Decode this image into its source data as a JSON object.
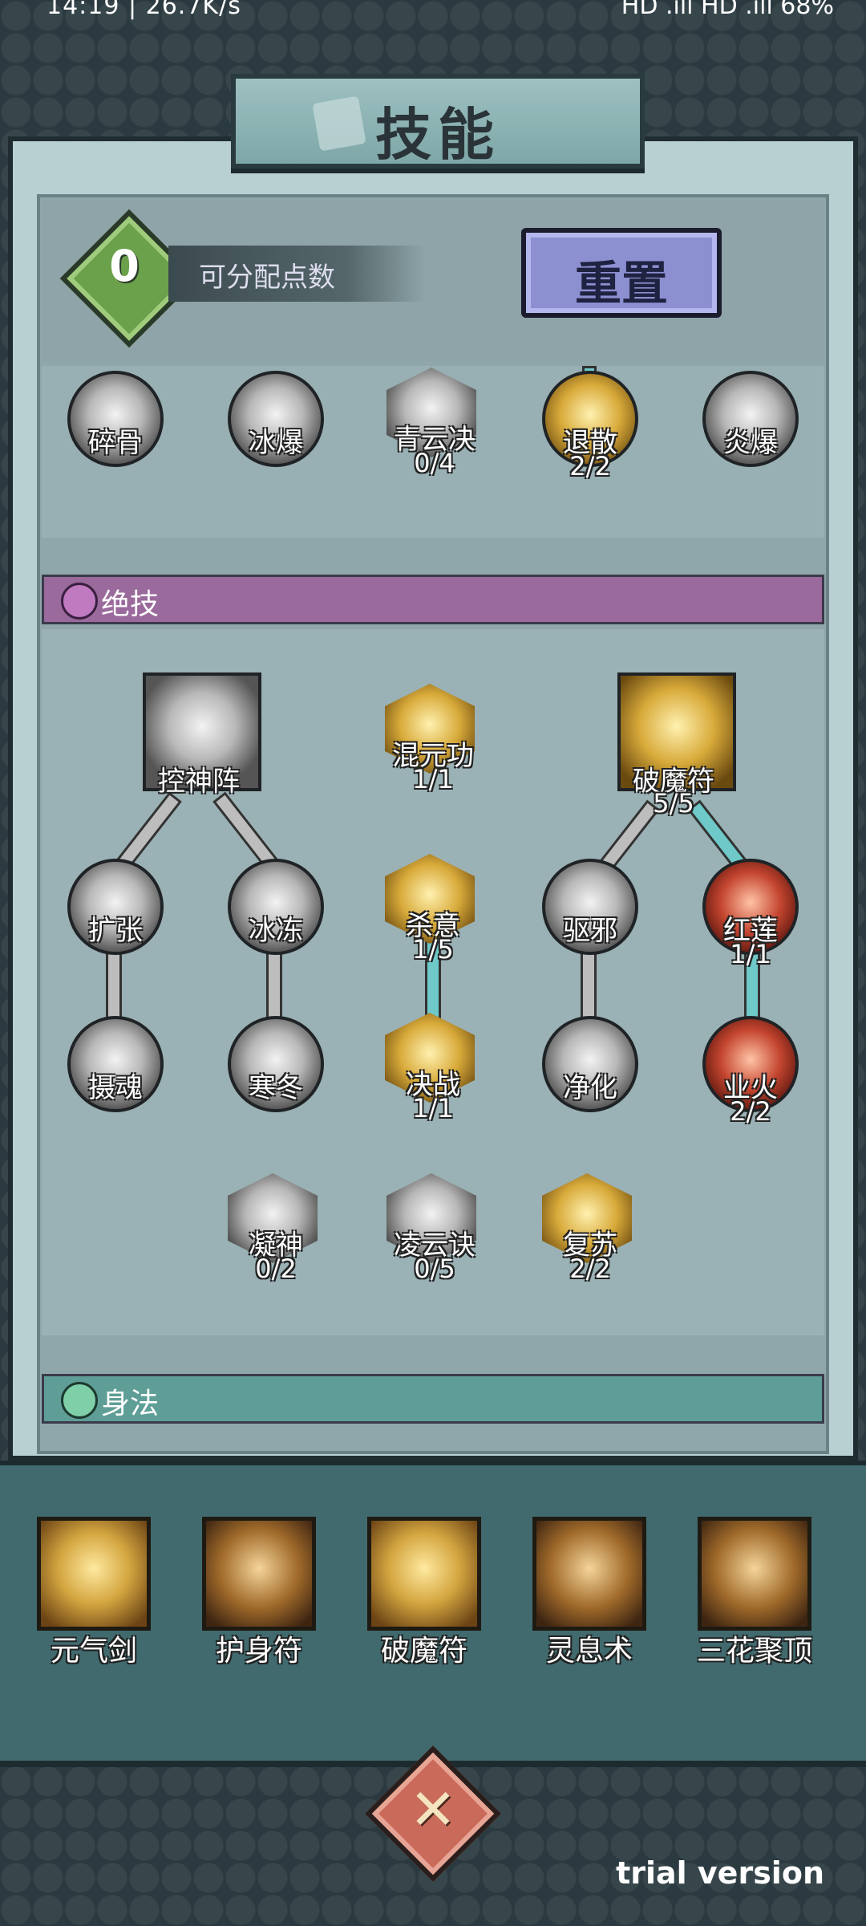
{
  "status": {
    "time_speed": "14:19 | 26.7K/s",
    "right": "HD .ıll HD .ıll 68%"
  },
  "title": "技能",
  "points": {
    "value": "0",
    "label": "可分配点数"
  },
  "reset_label": "重置",
  "top_row": [
    {
      "name": "碎骨",
      "count": ""
    },
    {
      "name": "冰爆",
      "count": ""
    },
    {
      "name": "青云决",
      "count": "0/4"
    },
    {
      "name": "退散",
      "count": "2/2"
    },
    {
      "name": "炎爆",
      "count": ""
    }
  ],
  "sections": {
    "ultimate": "绝技",
    "movement": "身法"
  },
  "tree": {
    "kongshenzhen": {
      "name": "控神阵",
      "count": ""
    },
    "hunyuangong": {
      "name": "混元功",
      "count": "1/1"
    },
    "pomofu": {
      "name": "破魔符",
      "count": "5/5"
    },
    "kuozhang": {
      "name": "扩张",
      "count": ""
    },
    "bingdong": {
      "name": "冰冻",
      "count": ""
    },
    "shayi": {
      "name": "杀意",
      "count": "1/5"
    },
    "quxie": {
      "name": "驱邪",
      "count": ""
    },
    "honglian": {
      "name": "红莲",
      "count": "1/1"
    },
    "shehun": {
      "name": "摄魂",
      "count": ""
    },
    "handong": {
      "name": "寒冬",
      "count": ""
    },
    "juezhan": {
      "name": "决战",
      "count": "1/1"
    },
    "jinghua": {
      "name": "净化",
      "count": ""
    },
    "yehuo": {
      "name": "业火",
      "count": "2/2"
    },
    "ningshen": {
      "name": "凝神",
      "count": "0/2"
    },
    "lingyunjue": {
      "name": "凌云诀",
      "count": "0/5"
    },
    "fusu": {
      "name": "复苏",
      "count": "2/2"
    }
  },
  "equipped": [
    "元气剑",
    "护身符",
    "破魔符",
    "灵息术",
    "三花聚顶"
  ],
  "watermark": "trial version",
  "colors": {
    "ultimate_bar": "#9b6a9c",
    "movement_bar": "#5f9e96",
    "link_active": "#6fc9c9"
  }
}
